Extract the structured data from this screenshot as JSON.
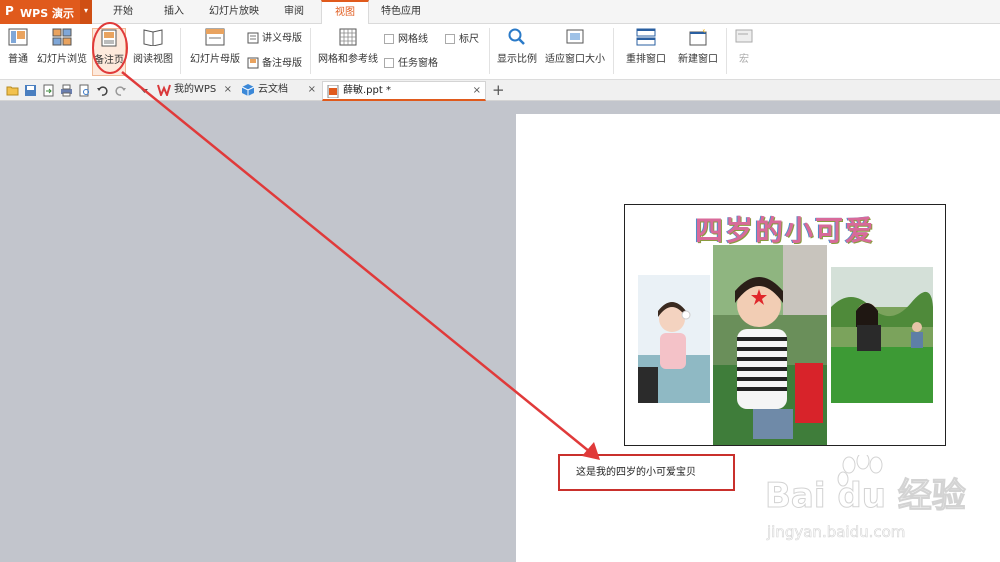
{
  "app": {
    "logo": "P",
    "name": "WPS 演示",
    "menu_caret": "▾"
  },
  "ribbon_tabs": [
    {
      "label": "开始"
    },
    {
      "label": "插入"
    },
    {
      "label": "幻灯片放映"
    },
    {
      "label": "审阅"
    },
    {
      "label": "视图",
      "active": true
    },
    {
      "label": "特色应用"
    }
  ],
  "ribbon": {
    "normal": "普通",
    "slide_sorter": "幻灯片浏览",
    "notes_page": "备注页",
    "reading_view": "阅读视图",
    "slide_master": "幻灯片母版",
    "handout_master": "讲义母版",
    "notes_master": "备注母版",
    "grid_guides": "网格和参考线",
    "gridlines": "网格线",
    "ruler": "标尺",
    "task_pane": "任务窗格",
    "zoom": "显示比例",
    "fit_window": "适应窗口大小",
    "arrange_window": "重排窗口",
    "new_window": "新建窗口",
    "macro": "宏"
  },
  "doc_tabs": [
    {
      "label": "我的WPS"
    },
    {
      "label": "云文档"
    },
    {
      "label": "薛敏.ppt *",
      "active": true
    }
  ],
  "tab_close": "×",
  "new_tab": "+",
  "slide": {
    "title": "四岁的小可爱"
  },
  "notes": {
    "text": "这是我的四岁的小可爱宝贝"
  },
  "watermark": {
    "brand": "Bai du 经验",
    "url": "jingyan.baidu.com"
  },
  "colors": {
    "accent": "#e05a1c",
    "annotation": "#e03a3a"
  }
}
